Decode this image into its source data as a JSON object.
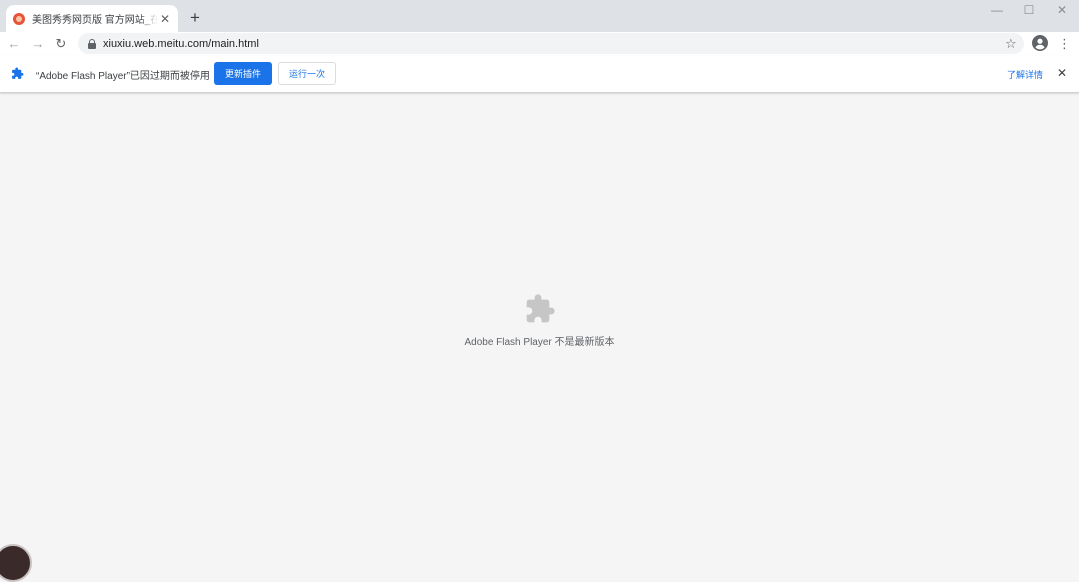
{
  "tab": {
    "title": "美图秀秀网页版 官方网站_在线P",
    "close_glyph": "✕",
    "favicon": "meitu-favicon-icon"
  },
  "new_tab_glyph": "+",
  "window_controls": {
    "minimize": "—",
    "maximize": "☐",
    "close": "✕"
  },
  "toolbar": {
    "back": "←",
    "forward": "→",
    "reload": "↻",
    "url": "xiuxiu.web.meitu.com/main.html",
    "star": "☆",
    "menu": "⋮"
  },
  "infobar": {
    "message": "“Adobe Flash Player”已因过期而被停用",
    "update_button": "更新插件",
    "run_once_button": "运行一次",
    "learn_more": "了解详情",
    "close_glyph": "✕"
  },
  "content": {
    "message": "Adobe Flash Player 不是最新版本"
  },
  "colors": {
    "accent": "#1a73e8",
    "tabstrip": "#dee1e6",
    "page_background": "#f5f5f5",
    "plugin_icon": "#c6c6c6"
  }
}
